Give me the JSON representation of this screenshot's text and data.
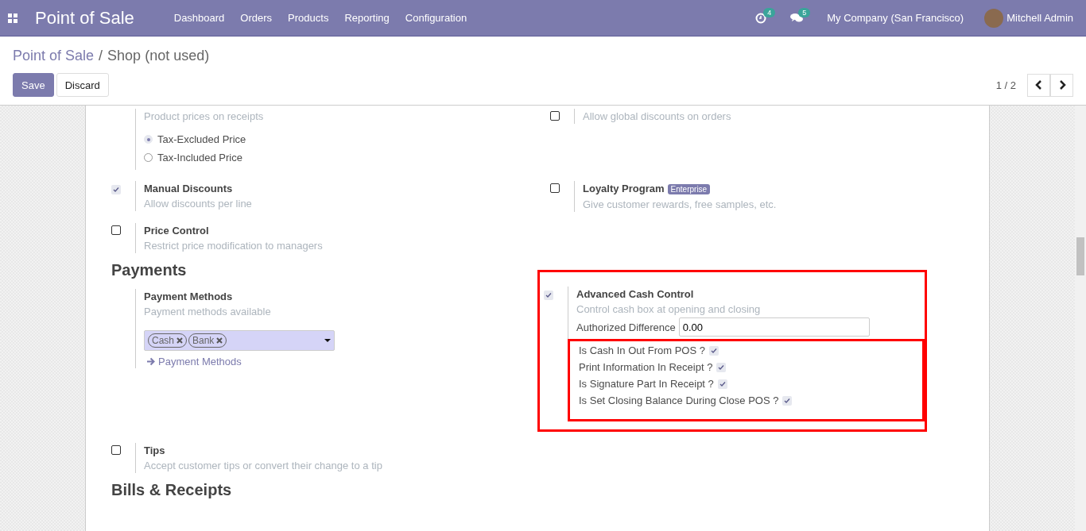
{
  "navbar": {
    "app_title": "Point of Sale",
    "menu": [
      {
        "label": "Dashboard"
      },
      {
        "label": "Orders"
      },
      {
        "label": "Products"
      },
      {
        "label": "Reporting"
      },
      {
        "label": "Configuration"
      }
    ],
    "activities_count": "4",
    "messages_count": "5",
    "company": "My Company (San Francisco)",
    "user": "Mitchell Admin"
  },
  "breadcrumb": {
    "items": [
      {
        "label": "Point of Sale",
        "kind": "link"
      },
      {
        "label": "Shop (not used)",
        "kind": "current"
      }
    ],
    "separator": "/"
  },
  "buttons": [
    {
      "label": "Save",
      "kind": "primary"
    },
    {
      "label": "Discard",
      "kind": "secondary"
    }
  ],
  "pager": {
    "value": "1 / 2"
  },
  "content": [
    {
      "kind": "row",
      "settings": [
        {
          "description": "Product prices on receipts",
          "radios": [
            {
              "label": "Tax-Excluded Price",
              "selected": true
            },
            {
              "label": "Tax-Included Price",
              "selected": false
            }
          ]
        },
        {
          "checked": false,
          "description": "Allow global discounts on orders"
        }
      ]
    },
    {
      "kind": "row",
      "settings": [
        {
          "checked": true,
          "title": "Manual Discounts",
          "description": "Allow discounts per line"
        },
        {
          "checked": false,
          "title": "Loyalty Program",
          "badge": "Enterprise",
          "description": "Give customer rewards, free samples, etc."
        }
      ]
    },
    {
      "kind": "row",
      "settings": [
        {
          "checked": false,
          "title": "Price Control",
          "description": "Restrict price modification to managers"
        }
      ]
    },
    {
      "kind": "heading",
      "text": "Payments"
    },
    {
      "kind": "row",
      "settings": [
        {
          "title": "Payment Methods",
          "description": "Payment methods available",
          "tags": [
            {
              "label": "Cash"
            },
            {
              "label": "Bank"
            }
          ],
          "link": "Payment Methods"
        },
        {
          "checked": true,
          "highlighted": true,
          "title": "Advanced Cash Control",
          "description": "Control cash box at opening and closing",
          "field": {
            "label": "Authorized Difference",
            "value": "0.00"
          },
          "options_highlighted": true,
          "options": [
            {
              "label": "Is Cash In Out From POS ?",
              "checked": true
            },
            {
              "label": "Print Information In Receipt ?",
              "checked": true
            },
            {
              "label": "Is Signature Part In Receipt ?",
              "checked": true
            },
            {
              "label": "Is Set Closing Balance During Close POS ?",
              "checked": true
            }
          ]
        }
      ]
    },
    {
      "kind": "row",
      "settings": [
        {
          "checked": false,
          "title": "Tips",
          "description": "Accept customer tips or convert their change to a tip"
        }
      ]
    },
    {
      "kind": "heading",
      "text": "Bills & Receipts"
    }
  ]
}
